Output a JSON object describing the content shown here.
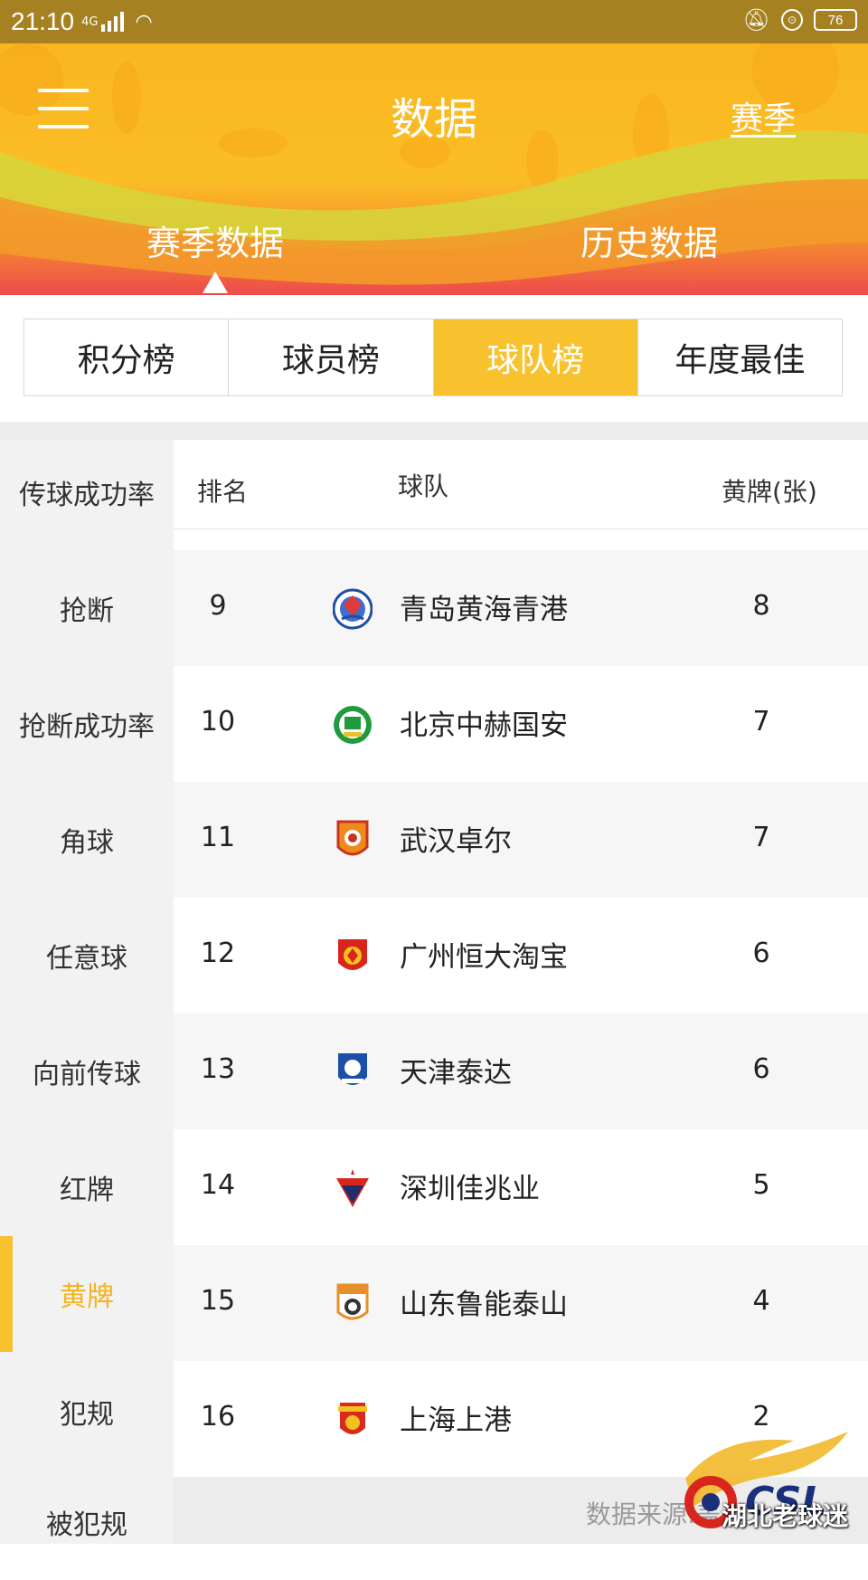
{
  "status_bar": {
    "time": "21:10",
    "network": "4G",
    "battery": "76"
  },
  "header": {
    "title": "数据",
    "season_link": "赛季",
    "tabs": [
      {
        "label": "赛季数据",
        "active": true
      },
      {
        "label": "历史数据",
        "active": false
      }
    ]
  },
  "segments": [
    {
      "label": "积分榜",
      "active": false
    },
    {
      "label": "球员榜",
      "active": false
    },
    {
      "label": "球队榜",
      "active": true
    },
    {
      "label": "年度最佳",
      "active": false
    }
  ],
  "categories": [
    {
      "label": "传球成功率"
    },
    {
      "label": "抢断"
    },
    {
      "label": "抢断成功率"
    },
    {
      "label": "角球"
    },
    {
      "label": "任意球"
    },
    {
      "label": "向前传球"
    },
    {
      "label": "红牌"
    },
    {
      "label": "黄牌",
      "active": true
    },
    {
      "label": "犯规"
    },
    {
      "label": "被犯规"
    }
  ],
  "table": {
    "headers": {
      "rank": "排名",
      "team": "球队",
      "value": "黄牌(张)"
    },
    "rows": [
      {
        "rank": "9",
        "team": "青岛黄海青港",
        "value": "8",
        "logo": "qingdao-logo"
      },
      {
        "rank": "10",
        "team": "北京中赫国安",
        "value": "7",
        "logo": "beijing-logo"
      },
      {
        "rank": "11",
        "team": "武汉卓尔",
        "value": "7",
        "logo": "wuhan-logo"
      },
      {
        "rank": "12",
        "team": "广州恒大淘宝",
        "value": "6",
        "logo": "guangzhou-logo"
      },
      {
        "rank": "13",
        "team": "天津泰达",
        "value": "6",
        "logo": "tianjin-logo"
      },
      {
        "rank": "14",
        "team": "深圳佳兆业",
        "value": "5",
        "logo": "shenzhen-logo"
      },
      {
        "rank": "15",
        "team": "山东鲁能泰山",
        "value": "4",
        "logo": "shandong-logo"
      },
      {
        "rank": "16",
        "team": "上海上港",
        "value": "2",
        "logo": "shanghai-logo"
      }
    ]
  },
  "footer": {
    "source": "数据来源:盖",
    "watermark": "湖北老球迷",
    "watermark_logo": "CSL"
  },
  "colors": {
    "accent": "#f8c22f",
    "statusbar": "#a58121",
    "header_top": "#f9b61f",
    "header_bottom": "#ee4a4c"
  }
}
